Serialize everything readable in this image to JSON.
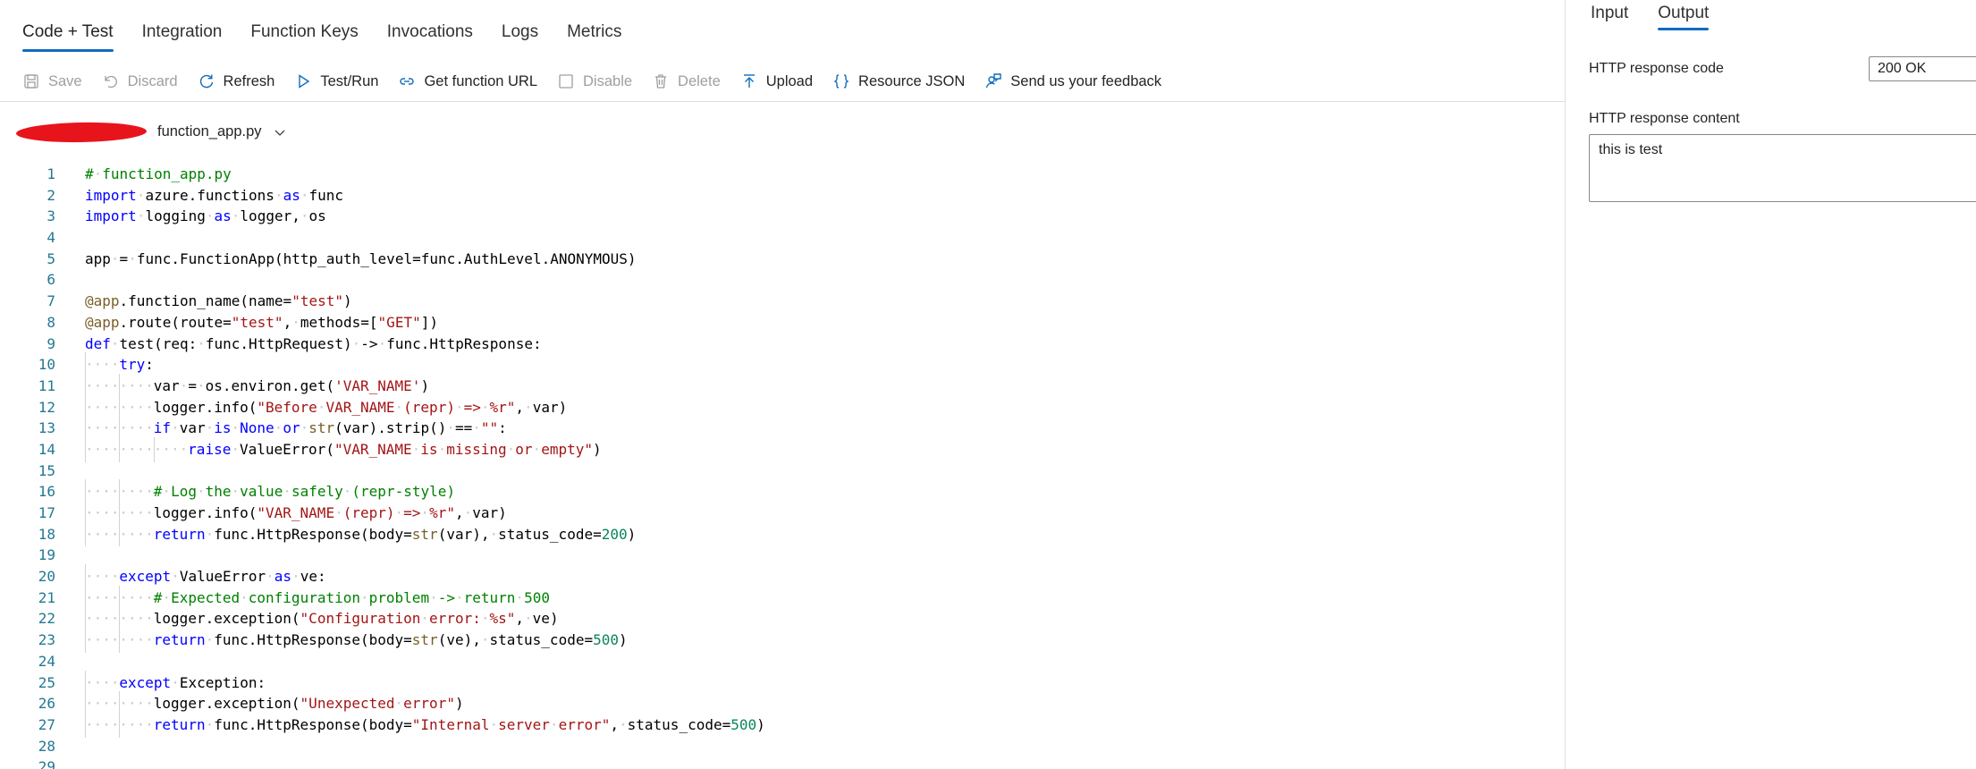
{
  "tabs": [
    {
      "label": "Code + Test",
      "active": true
    },
    {
      "label": "Integration"
    },
    {
      "label": "Function Keys"
    },
    {
      "label": "Invocations"
    },
    {
      "label": "Logs"
    },
    {
      "label": "Metrics"
    }
  ],
  "toolbar": {
    "save": "Save",
    "discard": "Discard",
    "refresh": "Refresh",
    "test_run": "Test/Run",
    "get_function_url": "Get function URL",
    "disable": "Disable",
    "delete": "Delete",
    "upload": "Upload",
    "resource_json": "Resource JSON",
    "feedback": "Send us your feedback"
  },
  "file": {
    "name": "function_app.py"
  },
  "code": {
    "line_numbers": [
      "1",
      "2",
      "3",
      "4",
      "5",
      "6",
      "7",
      "8",
      "9",
      "10",
      "11",
      "12",
      "13",
      "14",
      "15",
      "16",
      "17",
      "18",
      "19",
      "20",
      "21",
      "22",
      "23",
      "24",
      "25",
      "26",
      "27",
      "28",
      "29"
    ],
    "lines": [
      "# function_app.py",
      "import azure.functions as func",
      "import logging as logger, os",
      "",
      "app = func.FunctionApp(http_auth_level=func.AuthLevel.ANONYMOUS)",
      "",
      "@app.function_name(name=\"test\")",
      "@app.route(route=\"test\", methods=[\"GET\"])",
      "def test(req: func.HttpRequest) -> func.HttpResponse:",
      "    try:",
      "        var = os.environ.get('VAR_NAME')",
      "        logger.info(\"Before VAR_NAME (repr) => %r\", var)",
      "        if var is None or str(var).strip() == \"\":",
      "            raise ValueError(\"VAR_NAME is missing or empty\")",
      "",
      "        # Log the value safely (repr-style)",
      "        logger.info(\"VAR_NAME (repr) => %r\", var)",
      "        return func.HttpResponse(body=str(var), status_code=200)",
      "",
      "    except ValueError as ve:",
      "        # Expected configuration problem -> return 500",
      "        logger.exception(\"Configuration error: %s\", ve)",
      "        return func.HttpResponse(body=str(ve), status_code=500)",
      "",
      "    except Exception:",
      "        logger.exception(\"Unexpected error\")",
      "        return func.HttpResponse(body=\"Internal server error\", status_code=500)",
      "",
      ""
    ]
  },
  "panel": {
    "tabs": [
      {
        "label": "Input"
      },
      {
        "label": "Output",
        "active": true
      }
    ],
    "response_code_label": "HTTP response code",
    "response_code_value": "200 OK",
    "response_content_label": "HTTP response content",
    "response_content_value": "this is test"
  },
  "colors": {
    "accent": "#0f6cbd",
    "redaction": "#e8141c"
  }
}
